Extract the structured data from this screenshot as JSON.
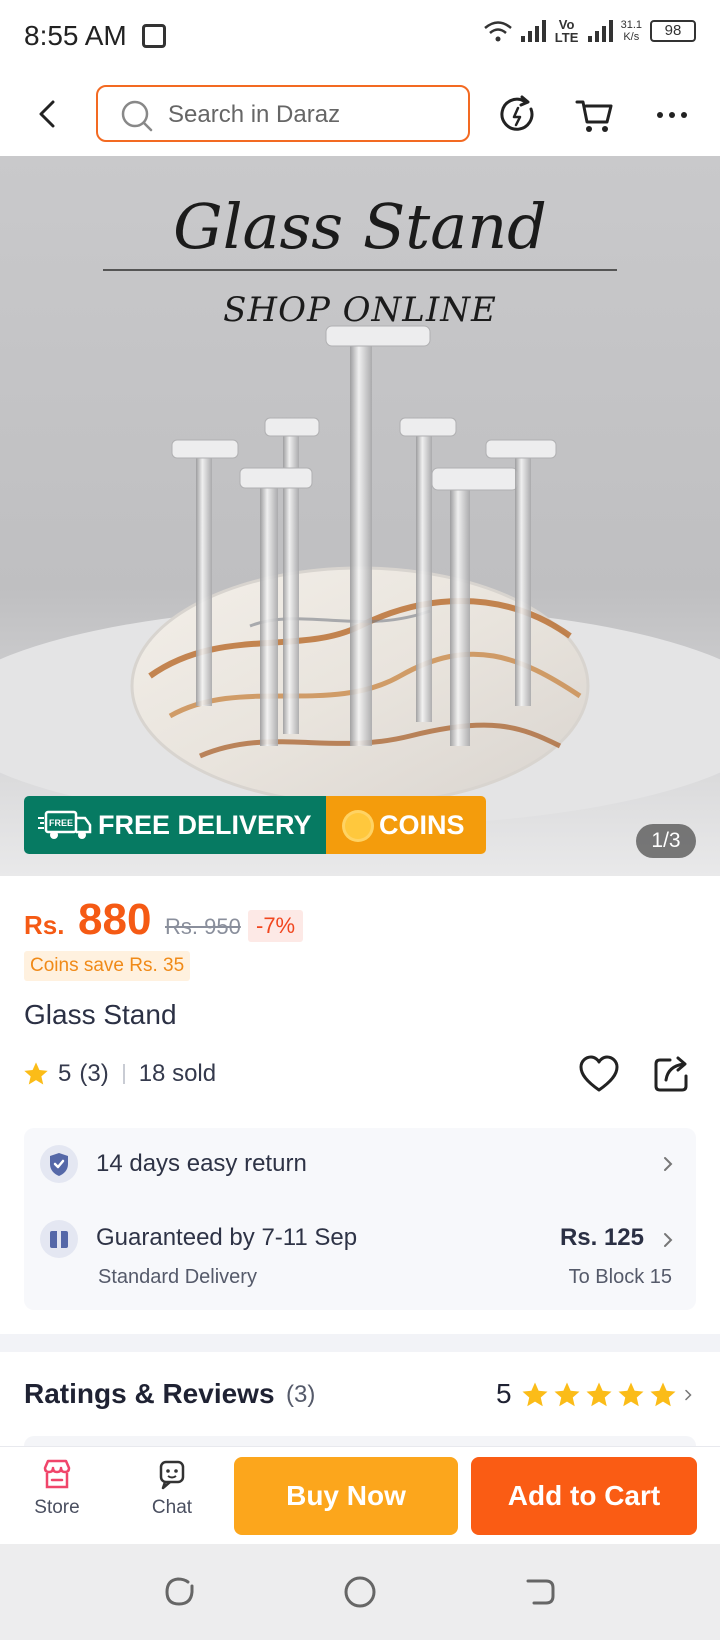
{
  "status_bar": {
    "time": "8:55 AM",
    "network_label": "Vo LTE",
    "speed_value": "31.1",
    "speed_unit": "K/s",
    "battery": "98"
  },
  "top_nav": {
    "search_placeholder": "Search in Daraz",
    "accent_color": "#f36a22"
  },
  "hero": {
    "title": "Glass Stand",
    "subtitle": "SHOP ONLINE",
    "free_delivery_badge": "FREE DELIVERY",
    "truck_text": "FREE",
    "coins_badge": "COINS",
    "pager": "1/3"
  },
  "product": {
    "currency": "Rs.",
    "price": "880",
    "old_price": "Rs. 950",
    "discount": "-7%",
    "coins_save": "Coins save Rs. 35",
    "title": "Glass Stand",
    "rating": "5",
    "rating_count": "(3)",
    "sold": "18 sold"
  },
  "service": {
    "return_text": "14 days easy return",
    "delivery_guarantee": "Guaranteed by 7-11 Sep",
    "delivery_type": "Standard Delivery",
    "delivery_fee": "Rs. 125",
    "delivery_location": "To Block 15"
  },
  "reviews": {
    "title": "Ratings & Reviews",
    "count": "(3)",
    "score": "5"
  },
  "bottom_bar": {
    "store_label": "Store",
    "chat_label": "Chat",
    "buy_now_label": "Buy Now",
    "add_to_cart_label": "Add to Cart",
    "buy_now_color": "#fca61c",
    "add_to_cart_color": "#fa5c14"
  }
}
